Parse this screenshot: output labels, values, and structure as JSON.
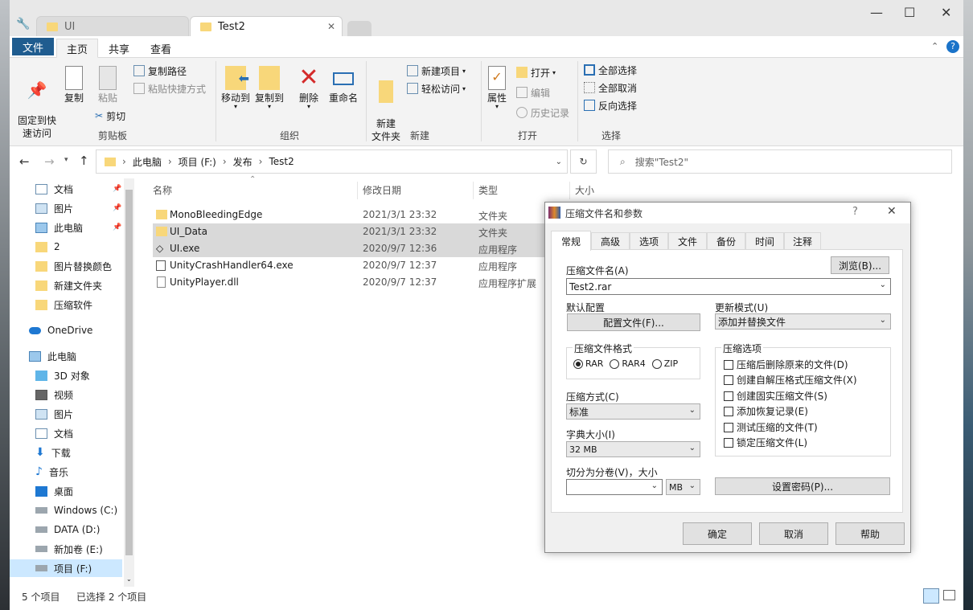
{
  "tabs": [
    {
      "label": "UI"
    },
    {
      "label": "Test2"
    }
  ],
  "ribbon_tabs": {
    "file": "文件",
    "home": "主页",
    "share": "共享",
    "view": "查看"
  },
  "ribbon": {
    "pin": "固定到快\n速访问",
    "copy": "复制",
    "paste": "粘贴",
    "copy_path": "复制路径",
    "paste_shortcut": "粘贴快捷方式",
    "cut": "剪切",
    "move_to": "移动到",
    "copy_to": "复制到",
    "delete": "删除",
    "rename": "重命名",
    "new_folder": "新建\n文件夹",
    "new_item": "新建项目",
    "easy_access": "轻松访问",
    "properties": "属性",
    "open": "打开",
    "edit": "编辑",
    "history": "历史记录",
    "select_all": "全部选择",
    "select_none": "全部取消",
    "invert": "反向选择",
    "groups": {
      "clipboard": "剪贴板",
      "organize": "组织",
      "new": "新建",
      "open": "打开",
      "select": "选择"
    }
  },
  "address": {
    "crumbs": [
      "此电脑",
      "项目 (F:)",
      "发布",
      "Test2"
    ],
    "search_placeholder": "搜索\"Test2\""
  },
  "nav": {
    "items": [
      "文档",
      "图片",
      "此电脑",
      "2",
      "图片替换颜色",
      "新建文件夹",
      "压缩软件",
      "OneDrive",
      "此电脑",
      "3D 对象",
      "视频",
      "图片",
      "文档",
      "下载",
      "音乐",
      "桌面",
      "Windows (C:)",
      "DATA (D:)",
      "新加卷 (E:)",
      "项目 (F:)"
    ]
  },
  "columns": {
    "name": "名称",
    "date": "修改日期",
    "type": "类型",
    "size": "大小"
  },
  "files": [
    {
      "name": "MonoBleedingEdge",
      "date": "2021/3/1 23:32",
      "type": "文件夹"
    },
    {
      "name": "UI_Data",
      "date": "2021/3/1 23:32",
      "type": "文件夹"
    },
    {
      "name": "UI.exe",
      "date": "2020/9/7 12:36",
      "type": "应用程序"
    },
    {
      "name": "UnityCrashHandler64.exe",
      "date": "2020/9/7 12:37",
      "type": "应用程序"
    },
    {
      "name": "UnityPlayer.dll",
      "date": "2020/9/7 12:37",
      "type": "应用程序扩展"
    }
  ],
  "status": {
    "count": "5 个项目",
    "selected": "已选择 2 个项目"
  },
  "dialog": {
    "title": "压缩文件名和参数",
    "help": "?",
    "tabs": [
      "常规",
      "高级",
      "选项",
      "文件",
      "备份",
      "时间",
      "注释"
    ],
    "archive_name_label": "压缩文件名(A)",
    "browse": "浏览(B)...",
    "archive_name": "Test2.rar",
    "profile_label": "默认配置",
    "profiles_button": "配置文件(F)...",
    "update_label": "更新模式(U)",
    "update_value": "添加并替换文件",
    "format_label": "压缩文件格式",
    "formats": [
      "RAR",
      "RAR4",
      "ZIP"
    ],
    "method_label": "压缩方式(C)",
    "method_value": "标准",
    "dict_label": "字典大小(I)",
    "dict_value": "32 MB",
    "split_label": "切分为分卷(V)，大小",
    "split_unit": "MB",
    "options_label": "压缩选项",
    "options": [
      "压缩后删除原来的文件(D)",
      "创建自解压格式压缩文件(X)",
      "创建固实压缩文件(S)",
      "添加恢复记录(E)",
      "测试压缩的文件(T)",
      "锁定压缩文件(L)"
    ],
    "password": "设置密码(P)...",
    "ok": "确定",
    "cancel": "取消",
    "helpbtn": "帮助"
  }
}
